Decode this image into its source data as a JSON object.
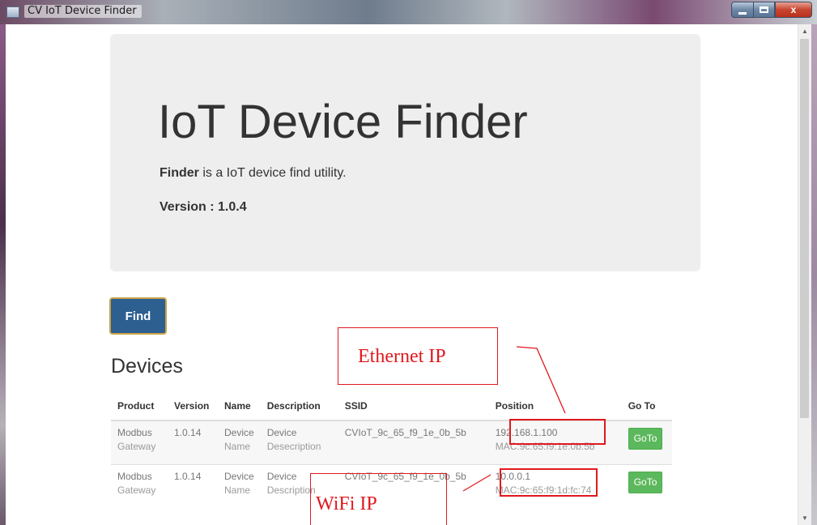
{
  "window": {
    "title": "CV IoT Device Finder",
    "controls": {
      "minimize": "minimize",
      "maximize": "maximize",
      "close": "x"
    }
  },
  "jumbotron": {
    "title": "IoT Device Finder",
    "tagline_strong": "Finder",
    "tagline_rest": " is a IoT device find utility.",
    "version": "Version : 1.0.4"
  },
  "find_button": "Find",
  "devices": {
    "heading": "Devices",
    "columns": [
      "Product",
      "Version",
      "Name",
      "Description",
      "SSID",
      "Position",
      "Go To"
    ],
    "rows": [
      {
        "product": [
          "Modbus",
          "Gateway"
        ],
        "version": "1.0.14",
        "name": [
          "Device",
          "Name"
        ],
        "description": [
          "Device",
          "Desecription"
        ],
        "ssid": "CVIoT_9c_65_f9_1e_0b_5b",
        "ip": "192.168.1.100",
        "mac": "MAC:9c:65:f9:1e:0b:5b",
        "goto": "GoTo"
      },
      {
        "product": [
          "Modbus",
          "Gateway"
        ],
        "version": "1.0.14",
        "name": [
          "Device",
          "Name"
        ],
        "description": [
          "Device",
          "Description"
        ],
        "ssid": "CVIoT_9c_65_f9_1e_0b_5b",
        "ip": "10.0.0.1",
        "mac": "MAC:9c:65:f9:1d:fc:74",
        "goto": "GoTo"
      }
    ]
  },
  "annotations": {
    "ethernet": "Ethernet IP",
    "wifi": "WiFi IP",
    "color": "#e0191f"
  },
  "colors": {
    "find_button": "#2d5f91",
    "goto_button": "#5cb85c",
    "jumbotron_bg": "#eeeeee"
  }
}
